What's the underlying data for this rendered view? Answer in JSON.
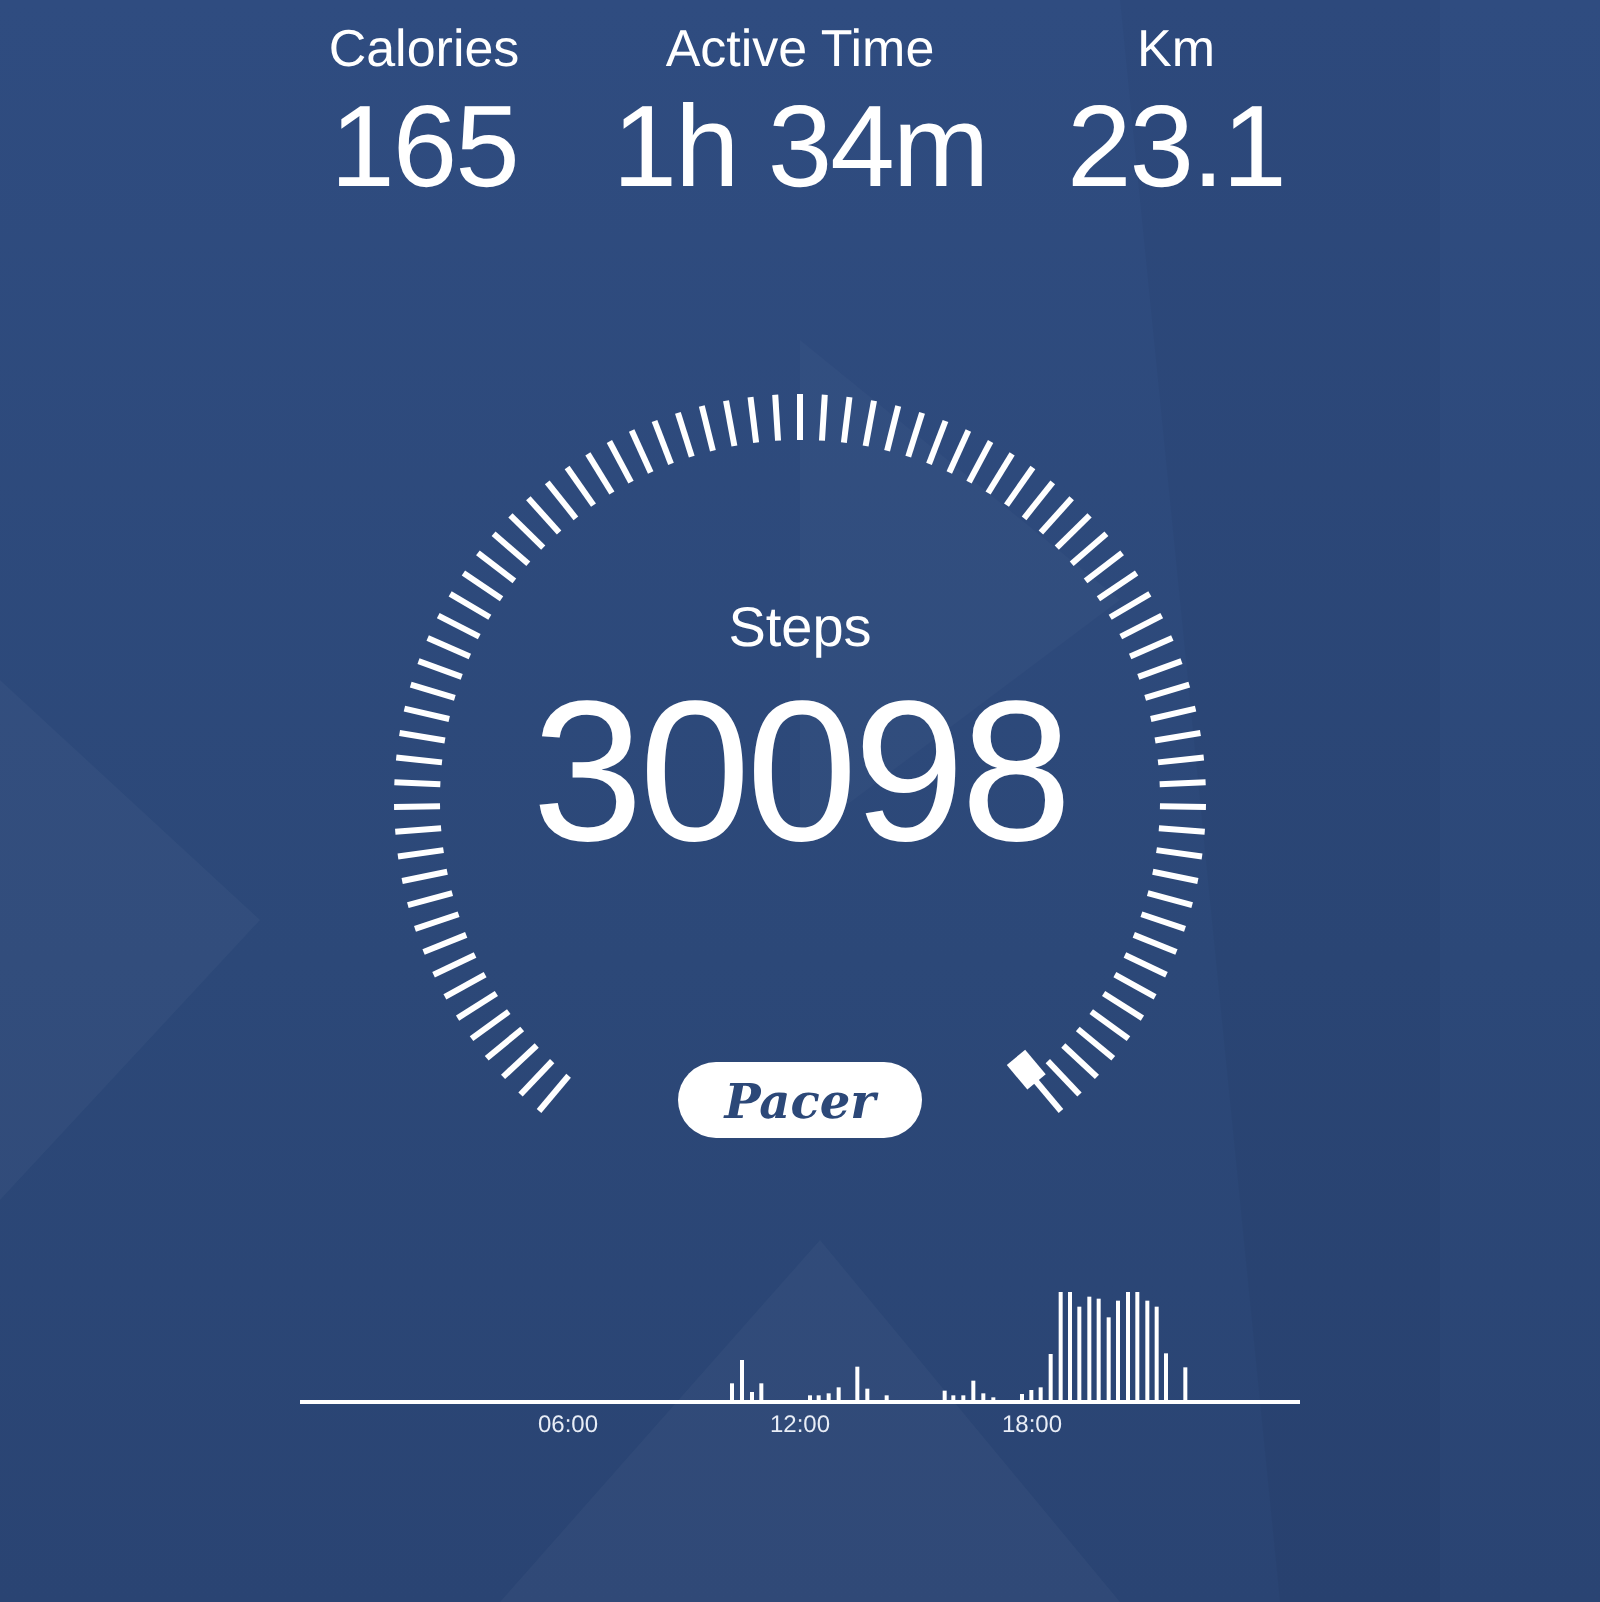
{
  "stats": [
    {
      "label": "Calories",
      "value": "165"
    },
    {
      "label": "Active Time",
      "value": "1h 34m"
    },
    {
      "label": "Km",
      "value": "23.1"
    }
  ],
  "gauge": {
    "label": "Steps",
    "value": "30098"
  },
  "brand": "Pacer",
  "timeline": {
    "ticks": [
      "06:00",
      "12:00",
      "18:00"
    ]
  }
}
